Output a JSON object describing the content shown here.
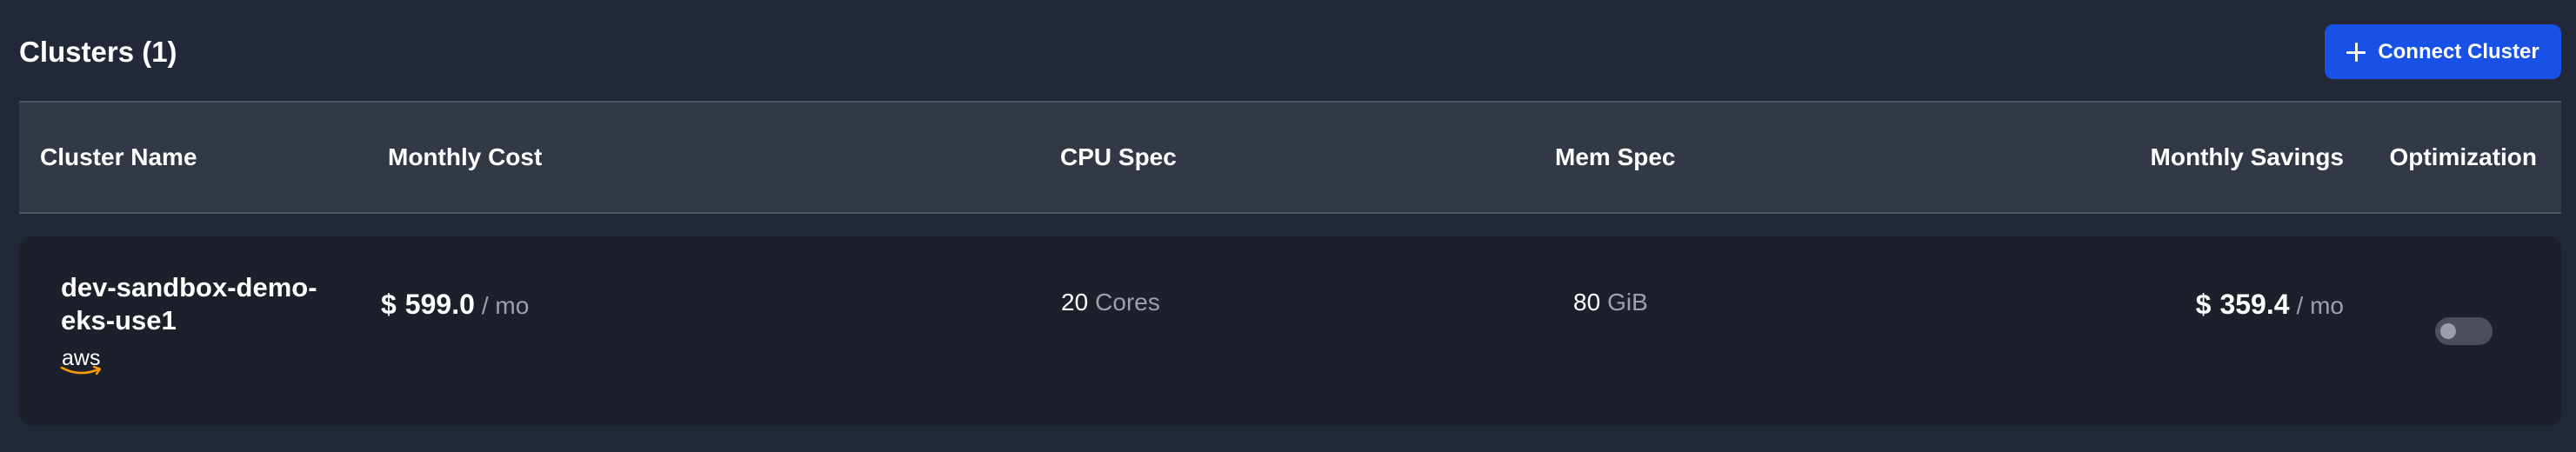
{
  "header": {
    "title": "Clusters (1)",
    "connect_button_label": "Connect Cluster"
  },
  "table": {
    "columns": [
      "Cluster Name",
      "Monthly Cost",
      "CPU Spec",
      "Mem Spec",
      "Monthly Savings",
      "Optimization"
    ],
    "rows": [
      {
        "cluster_name": "dev-sandbox-demo-eks-use1",
        "provider_icon": "aws-logo",
        "provider_label": "aws",
        "monthly_cost_currency": "$",
        "monthly_cost_value": "599.0",
        "monthly_cost_unit": "/ mo",
        "cpu_value": "20",
        "cpu_unit": "Cores",
        "mem_value": "80",
        "mem_unit": "GiB",
        "savings_currency": "$",
        "savings_value": "359.4",
        "savings_unit": "/ mo",
        "optimization_enabled": false
      }
    ]
  },
  "colors": {
    "background": "#222837",
    "header_row": "#323846",
    "data_row": "#1b202b",
    "accent_button": "#1751e6",
    "muted_text": "#9ba1ac",
    "aws_orange": "#ff9900"
  },
  "icons": {
    "button_icon": "plus-icon",
    "toggle": "toggle-switch"
  }
}
